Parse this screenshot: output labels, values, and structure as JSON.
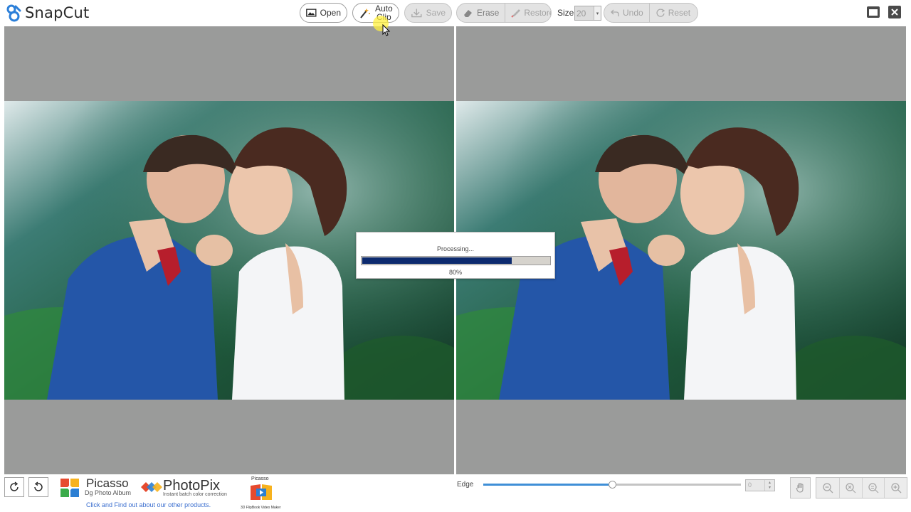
{
  "app": {
    "name": "SnapCut"
  },
  "toolbar": {
    "open_label": "Open",
    "autoclip_line1": "Auto",
    "autoclip_line2": "Clip",
    "save_label": "Save",
    "erase_label": "Erase",
    "restore_label": "Restore",
    "size_label": "Size",
    "size_value": "20",
    "undo_label": "Undo",
    "reset_label": "Reset"
  },
  "dialog": {
    "message": "Processing...",
    "progress": 0.8,
    "percent_label": "80%"
  },
  "bottom": {
    "promo1_title": "Picasso",
    "promo1_sub": "Dg  Photo Album",
    "promo2_title": "PhotoPix",
    "promo2_sub": "Instant batch color correction",
    "promo3_title": "Picasso",
    "promo3_sub": "3D FlipBook Video Maker",
    "promo_link": "Click and Find out about our other products.",
    "edge_label": "Edge",
    "edge_slider": 0.5,
    "edge_value": "0"
  },
  "icons": [
    "image-icon",
    "magic-wand-icon",
    "save-icon",
    "eraser-icon",
    "restore-brush-icon",
    "undo-icon",
    "reset-icon",
    "maximize-icon",
    "close-icon",
    "rotate-cw-icon",
    "rotate-ccw-icon",
    "hand-icon",
    "zoom-out-icon",
    "zoom-fit-icon",
    "zoom-actual-icon",
    "zoom-in-icon"
  ],
  "colors": {
    "canvas_bg": "#9a9b9a",
    "progress_fill": "#0c2a6e",
    "slider_fill": "#3f8fd7",
    "link": "#3a6ecf"
  }
}
